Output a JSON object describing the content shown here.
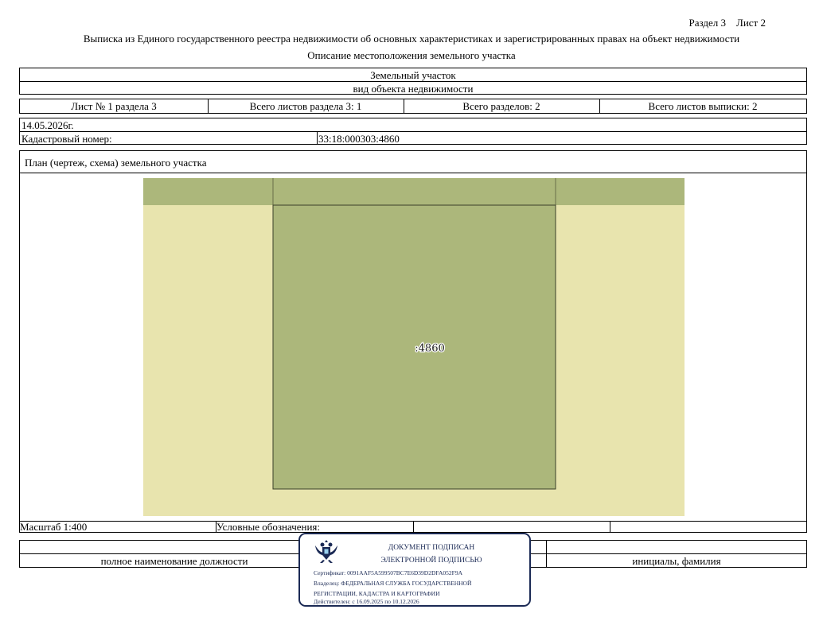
{
  "header": {
    "section": "Раздел 3",
    "sheet": "Лист 2"
  },
  "title": "Выписка из Единого государственного реестра недвижимости об основных характеристиках и зарегистрированных правах на объект недвижимости",
  "subtitle": "Описание местоположения земельного участка",
  "object": {
    "type": "Земельный участок",
    "type_caption": "вид объекта недвижимости"
  },
  "sheets": {
    "sheet_no": "Лист № 1 раздела 3",
    "section_total": "Всего листов раздела 3: 1",
    "sections_total": "Всего разделов: 2",
    "extract_total": "Всего листов выписки: 2"
  },
  "date": "14.05.2026г.",
  "cadastral": {
    "label": "Кадастровый номер:",
    "value": "33:18:000303:4860"
  },
  "plan": {
    "title": "План (чертеж, схема) земельного участка",
    "parcel_label": ":4860",
    "colors": {
      "background": "#e8e4ae",
      "strip": "#acb77b",
      "parcel": "#acb77b",
      "parcel_border": "#3a3f2a"
    }
  },
  "legend": {
    "scale": "Масштаб 1:400",
    "symbols": "Условные обозначения:"
  },
  "signature": {
    "position_caption": "полное наименование должности",
    "name_caption": "инициалы, фамилия"
  },
  "stamp": {
    "line1": "ДОКУМЕНТ ПОДПИСАН",
    "line2": "ЭЛЕКТРОННОЙ ПОДПИСЬЮ",
    "certificate": "Сертификат: 0091AAF5A599507BC7E6D39D2DFA052F9A",
    "owner1": "Владелец: ФЕДЕРАЛЬНАЯ СЛУЖБА ГОСУДАРСТВЕННОЙ",
    "owner2": "РЕГИСТРАЦИИ, КАДАСТРА И КАРТОГРАФИИ",
    "valid": "Действителен: с 16.09.2025 по 10.12.2026",
    "emblem": "eagle-emblem-icon",
    "border_color": "#1b2a55"
  }
}
